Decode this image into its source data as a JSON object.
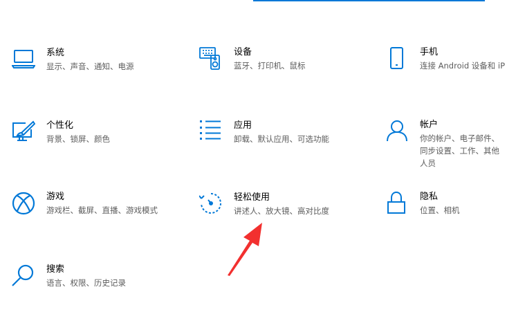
{
  "categories": [
    {
      "id": "system",
      "title": "系统",
      "desc": "显示、声音、通知、电源",
      "icon": "laptop-icon"
    },
    {
      "id": "devices",
      "title": "设备",
      "desc": "蓝牙、打印机、鼠标",
      "icon": "keyboard-speaker-icon"
    },
    {
      "id": "phone",
      "title": "手机",
      "desc": "连接 Android 设备和 iP",
      "icon": "phone-icon"
    },
    {
      "id": "personalization",
      "title": "个性化",
      "desc": "背景、锁屏、颜色",
      "icon": "paintbrush-monitor-icon"
    },
    {
      "id": "apps",
      "title": "应用",
      "desc": "卸载、默认应用、可选功能",
      "icon": "app-list-icon"
    },
    {
      "id": "accounts",
      "title": "帐户",
      "desc": "你的帐户、电子邮件、同步设置、工作、其他人员",
      "icon": "person-icon"
    },
    {
      "id": "gaming",
      "title": "游戏",
      "desc": "游戏栏、截屏、直播、游戏模式",
      "icon": "xbox-icon"
    },
    {
      "id": "ease-of-access",
      "title": "轻松使用",
      "desc": "讲述人、放大镜、高对比度",
      "icon": "ease-of-access-icon"
    },
    {
      "id": "privacy",
      "title": "隐私",
      "desc": "位置、相机",
      "icon": "lock-icon"
    },
    {
      "id": "search",
      "title": "搜索",
      "desc": "语言、权限、历史记录",
      "icon": "search-icon"
    }
  ],
  "colors": {
    "accent": "#0078d7",
    "annotation_arrow": "#f2302f"
  }
}
